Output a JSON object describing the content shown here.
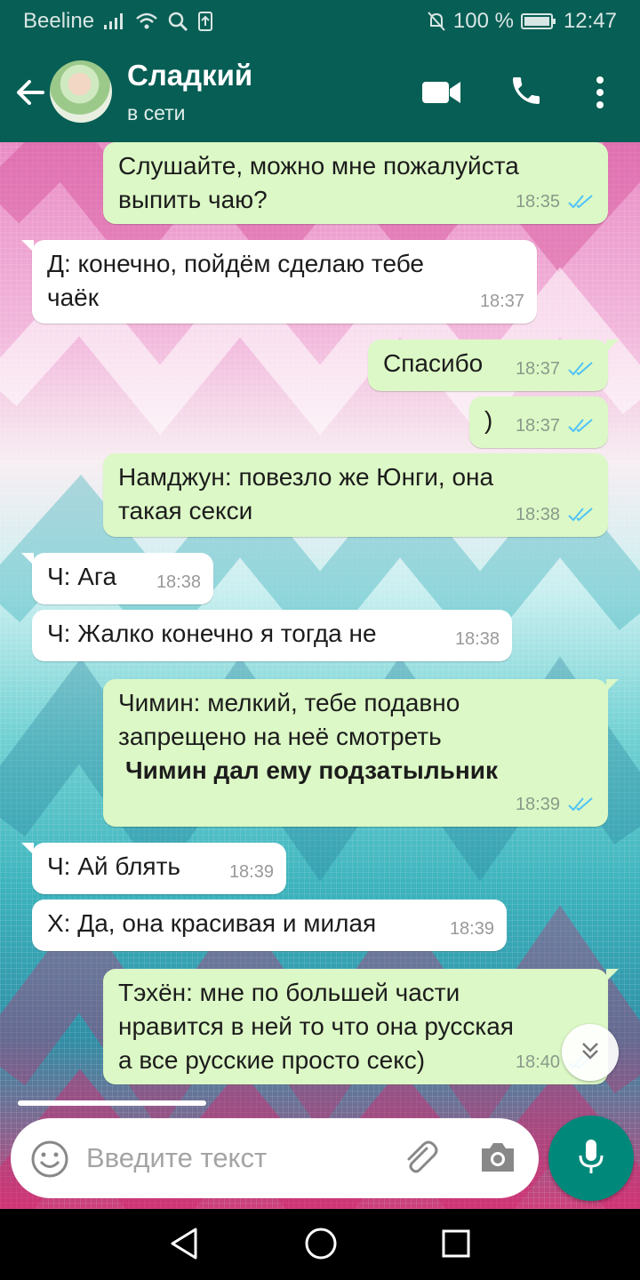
{
  "status_bar": {
    "carrier": "Beeline",
    "battery": "100 %",
    "time": "12:47"
  },
  "header": {
    "contact_name": "Сладкий",
    "presence": "в сети"
  },
  "messages": [
    {
      "direction": "out",
      "text": "Слушайте, можно мне пожалуйста\nвыпить чаю?",
      "time": "18:35",
      "read": true
    },
    {
      "direction": "in",
      "text": "Д: конечно, пойдём сделаю тебе\nчаёк",
      "time": "18:37"
    },
    {
      "direction": "out",
      "text": "Спасибо",
      "time": "18:37",
      "read": true
    },
    {
      "direction": "out",
      "text": ")",
      "time": "18:37",
      "read": true
    },
    {
      "direction": "out",
      "text": "Намджун: повезло же Юнги, она\nтакая секси",
      "time": "18:38",
      "read": true
    },
    {
      "direction": "in",
      "text": "Ч: Ага",
      "time": "18:38"
    },
    {
      "direction": "in",
      "text": "Ч: Жалко конечно я тогда не",
      "time": "18:38"
    },
    {
      "direction": "out",
      "text": "Чимин: мелкий, тебе подавно\nзапрещено на неё смотреть",
      "bold_text": "Чимин дал ему подзатыльник",
      "time": "18:39",
      "read": true
    },
    {
      "direction": "in",
      "text": "Ч: Ай блять",
      "time": "18:39"
    },
    {
      "direction": "in",
      "text": "Х: Да, она красивая и милая",
      "time": "18:39"
    },
    {
      "direction": "out",
      "text": "Тэхён: мне по большей части\nнравится в ней то что она русская\nа все русские просто секс)",
      "time": "18:40",
      "read": true
    }
  ],
  "composer": {
    "placeholder": "Введите текст"
  },
  "colors": {
    "header": "#075e54",
    "outgoing_bubble": "#dcf8c6",
    "incoming_bubble": "#ffffff",
    "read_ticks": "#4fc3f7",
    "mic_button": "#00897b"
  },
  "icons": [
    "back-arrow-icon",
    "video-call-icon",
    "phone-icon",
    "more-vert-icon",
    "emoji-icon",
    "attach-icon",
    "camera-icon",
    "mic-icon",
    "scroll-down-icon"
  ]
}
